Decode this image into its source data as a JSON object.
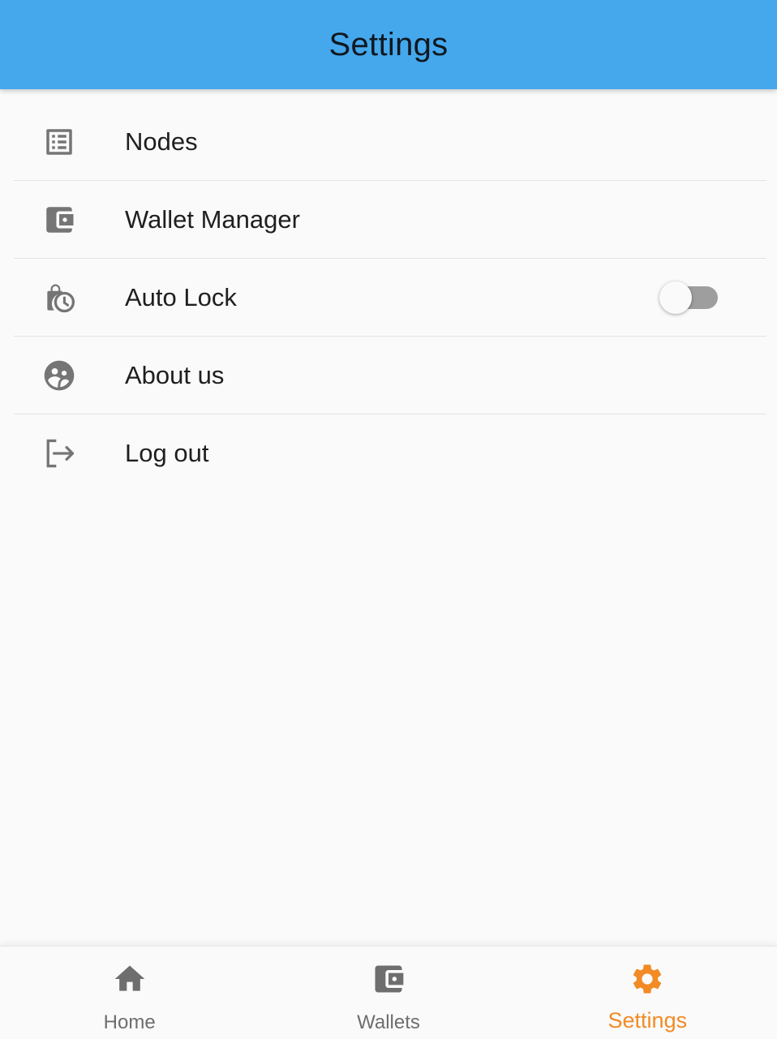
{
  "app_bar": {
    "title": "Settings"
  },
  "settings": {
    "items": [
      {
        "label": "Nodes",
        "icon": "list-alt-icon"
      },
      {
        "label": "Wallet Manager",
        "icon": "wallet-icon"
      },
      {
        "label": "Auto Lock",
        "icon": "lock-clock-icon",
        "toggle": false
      },
      {
        "label": "About us",
        "icon": "group-icon"
      },
      {
        "label": "Log out",
        "icon": "logout-icon"
      }
    ]
  },
  "bottom_nav": {
    "items": [
      {
        "label": "Home",
        "icon": "home-icon",
        "active": false
      },
      {
        "label": "Wallets",
        "icon": "wallet-icon",
        "active": false
      },
      {
        "label": "Settings",
        "icon": "gear-icon",
        "active": true
      }
    ]
  },
  "colors": {
    "app_bar": "#45a8ec",
    "accent": "#f28b25",
    "icon": "#757575",
    "background": "#fafafa"
  }
}
